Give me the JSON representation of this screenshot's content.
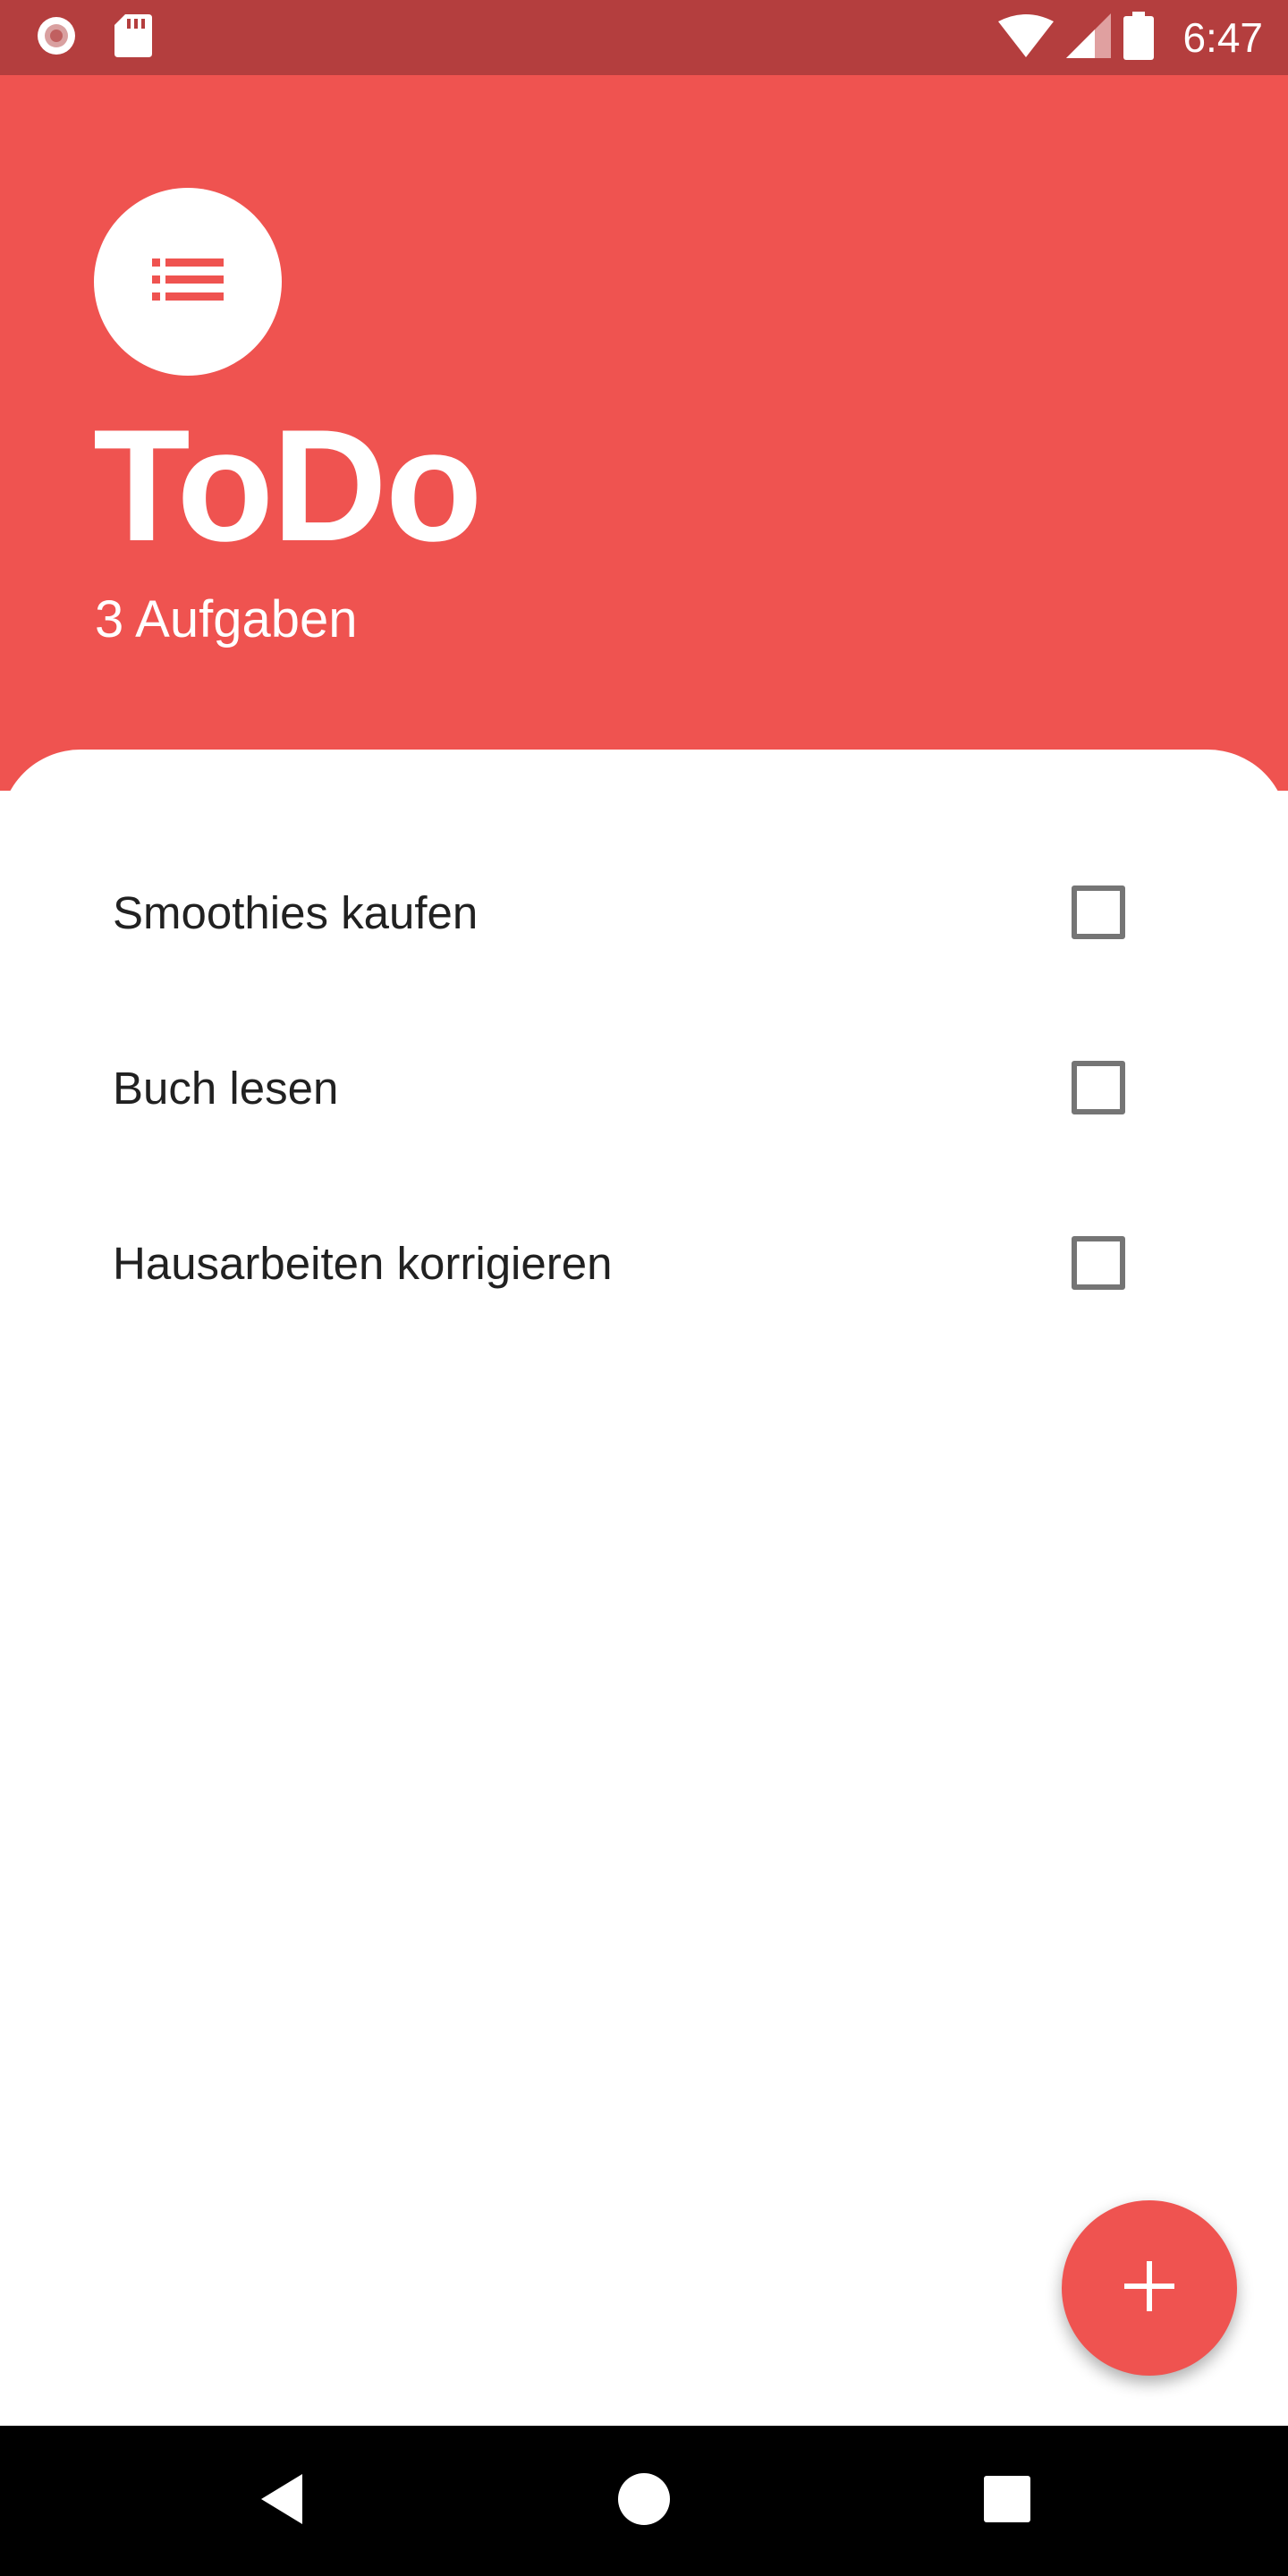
{
  "status_bar": {
    "time": "6:47",
    "left_icons": [
      "screen-record-icon",
      "sd-card-icon"
    ],
    "right_icons": [
      "wifi-icon",
      "signal-icon",
      "battery-icon"
    ],
    "background_color": "#b43e3e"
  },
  "header": {
    "title": "ToDo",
    "subtitle": "3 Aufgaben",
    "icon": "list-icon",
    "background_color": "#ef5350"
  },
  "tasks": [
    {
      "label": "Smoothies kaufen",
      "checked": false
    },
    {
      "label": "Buch lesen",
      "checked": false
    },
    {
      "label": "Hausarbeiten korrigieren",
      "checked": false
    }
  ],
  "fab": {
    "icon": "plus-icon",
    "color": "#ef5350"
  },
  "nav_bar": {
    "buttons": [
      "back-icon",
      "home-icon",
      "recents-icon"
    ]
  }
}
